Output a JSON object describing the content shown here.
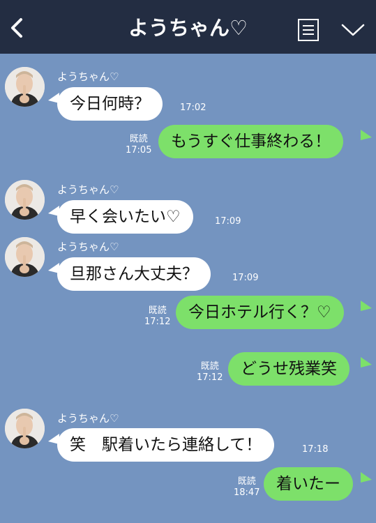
{
  "header": {
    "title": "ようちゃん♡"
  },
  "messages": [
    {
      "name": "ようちゃん♡",
      "text": "今日何時？",
      "time": "17:02"
    },
    {
      "read": "既読",
      "time": "17:05",
      "text": "もうすぐ仕事終わる！"
    },
    {
      "name": "ようちゃん♡",
      "text": "早く会いたい♡",
      "time": "17:09"
    },
    {
      "name": "ようちゃん♡",
      "text": "旦那さん大丈夫？",
      "time": "17:09"
    },
    {
      "read": "既読",
      "time": "17:12",
      "text": "今日ホテル行く？♡"
    },
    {
      "read": "既読",
      "time": "17:12",
      "text": "どうせ残業笑"
    },
    {
      "name": "ようちゃん♡",
      "text": "笑　駅着いたら連絡して！",
      "time": "17:18"
    },
    {
      "read": "既読",
      "time": "18:47",
      "text": "着いたー"
    }
  ],
  "colors": {
    "header_bg": "#232d42",
    "chat_bg": "#7494c0",
    "out_bubble": "#7de06a",
    "in_bubble": "#ffffff"
  },
  "icons": [
    "back-icon",
    "menu-icon",
    "chevron-down-icon",
    "avatar"
  ]
}
